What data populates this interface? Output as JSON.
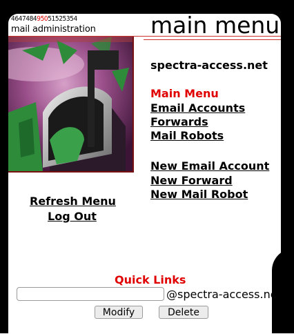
{
  "header": {
    "code_prefix": "4647484",
    "code_highlight": "950",
    "code_suffix": "51525354",
    "subtitle": "mail administration",
    "title": "main menu"
  },
  "domain": "spectra-access.net",
  "menu": {
    "main_menu": "Main Menu",
    "email_accounts": "Email Accounts",
    "forwards": "Forwards",
    "mail_robots": "Mail Robots",
    "new_email_account": "New Email Account",
    "new_forward": "New Forward",
    "new_mail_robot": "New Mail Robot"
  },
  "left": {
    "refresh_menu": "Refresh Menu",
    "log_out": "Log Out"
  },
  "quick_links": {
    "title": "Quick Links",
    "input_value": "",
    "suffix": "@spectra-access.net",
    "modify_label": "Modify",
    "delete_label": "Delete"
  },
  "colors": {
    "accent_red": "#e00000",
    "rule_red": "#c9302c",
    "frame": "#000000"
  }
}
